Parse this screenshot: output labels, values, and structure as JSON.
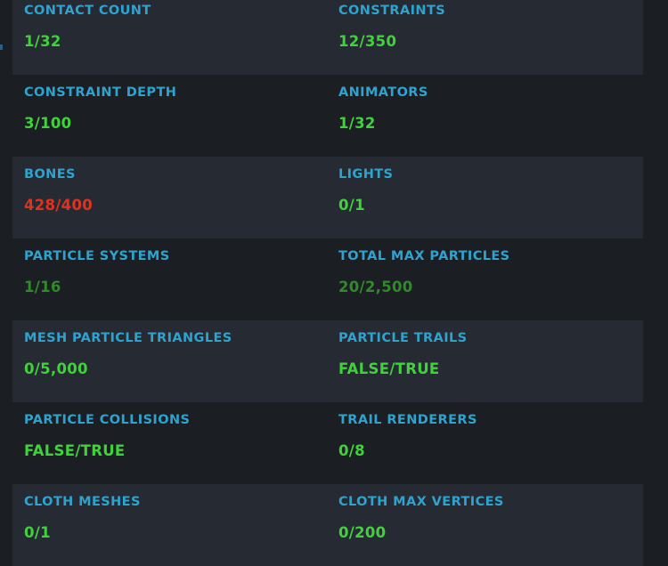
{
  "colors": {
    "background": "#1b1e23",
    "row_shaded": "#262a33",
    "label": "#2fa3cf",
    "ok": "#3fd23a",
    "dim_ok": "#2f8a28",
    "error": "#e0321e"
  },
  "stats": [
    {
      "left": {
        "label": "CONTACT COUNT",
        "value": "1/32",
        "status": "ok"
      },
      "right": {
        "label": "CONSTRAINTS",
        "value": "12/350",
        "status": "ok"
      }
    },
    {
      "left": {
        "label": "CONSTRAINT DEPTH",
        "value": "3/100",
        "status": "ok"
      },
      "right": {
        "label": "ANIMATORS",
        "value": "1/32",
        "status": "ok"
      }
    },
    {
      "left": {
        "label": "BONES",
        "value": "428/400",
        "status": "error"
      },
      "right": {
        "label": "LIGHTS",
        "value": "0/1",
        "status": "ok"
      }
    },
    {
      "left": {
        "label": "PARTICLE SYSTEMS",
        "value": "1/16",
        "status": "dim_ok"
      },
      "right": {
        "label": "TOTAL MAX PARTICLES",
        "value": "20/2,500",
        "status": "dim_ok"
      }
    },
    {
      "left": {
        "label": "MESH PARTICLE TRIANGLES",
        "value": "0/5,000",
        "status": "ok"
      },
      "right": {
        "label": "PARTICLE TRAILS",
        "value": "FALSE/TRUE",
        "status": "ok"
      }
    },
    {
      "left": {
        "label": "PARTICLE COLLISIONS",
        "value": "FALSE/TRUE",
        "status": "ok"
      },
      "right": {
        "label": "TRAIL RENDERERS",
        "value": "0/8",
        "status": "ok"
      }
    },
    {
      "left": {
        "label": "CLOTH MESHES",
        "value": "0/1",
        "status": "ok"
      },
      "right": {
        "label": "CLOTH MAX VERTICES",
        "value": "0/200",
        "status": "ok"
      }
    }
  ]
}
